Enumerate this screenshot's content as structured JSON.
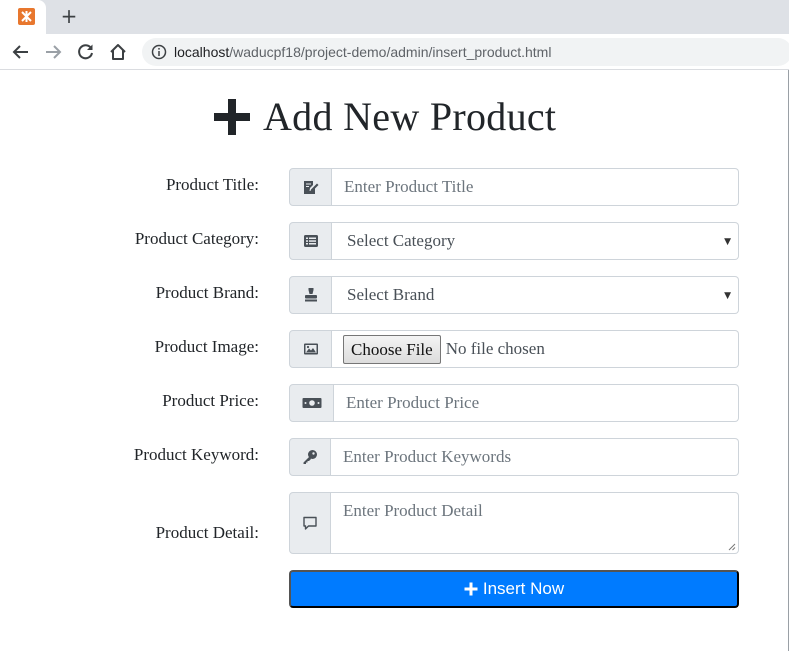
{
  "browser": {
    "new_tab": "+",
    "url_host": "localhost",
    "url_path": "/waducpf18/project-demo/admin/insert_product.html"
  },
  "page": {
    "title": "Add New Product"
  },
  "form": {
    "fields": [
      {
        "label": "Product Title:",
        "placeholder": "Enter Product Title",
        "icon": "edit-icon"
      },
      {
        "label": "Product Category:",
        "selected": "Select Category",
        "icon": "list-icon"
      },
      {
        "label": "Product Brand:",
        "selected": "Select Brand",
        "icon": "stamp-icon"
      },
      {
        "label": "Product Image:",
        "button": "Choose File",
        "status": "No file chosen",
        "icon": "image-icon"
      },
      {
        "label": "Product Price:",
        "placeholder": "Enter Product Price",
        "icon": "money-icon"
      },
      {
        "label": "Product Keyword:",
        "placeholder": "Enter Product Keywords",
        "icon": "key-icon"
      },
      {
        "label": "Product Detail:",
        "placeholder": "Enter Product Detail",
        "icon": "comment-icon"
      }
    ],
    "submit_label": "Insert Now"
  },
  "colors": {
    "primary": "#007bff",
    "addon_bg": "#e9ecef",
    "border": "#ced4da",
    "xampp_orange": "#e8772e"
  }
}
